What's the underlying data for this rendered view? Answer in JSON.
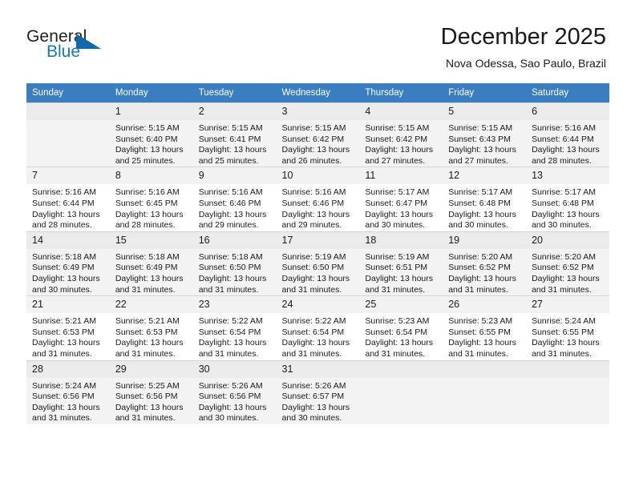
{
  "brand": {
    "name_top": "General",
    "name_bottom": "Blue",
    "color_primary": "#1268ad",
    "color_text": "#231f20"
  },
  "header": {
    "month_title": "December 2025",
    "location": "Nova Odessa, Sao Paulo, Brazil"
  },
  "calendar": {
    "header_bg": "#3a7dc0",
    "header_text_color": "#ffffff",
    "weekday_headers": [
      "Sunday",
      "Monday",
      "Tuesday",
      "Wednesday",
      "Thursday",
      "Friday",
      "Saturday"
    ],
    "weeks": [
      [
        {
          "day": "",
          "sunrise": "",
          "sunset": "",
          "daylight_line1": "",
          "daylight_line2": ""
        },
        {
          "day": "1",
          "sunrise": "Sunrise: 5:15 AM",
          "sunset": "Sunset: 6:40 PM",
          "daylight_line1": "Daylight: 13 hours",
          "daylight_line2": "and 25 minutes."
        },
        {
          "day": "2",
          "sunrise": "Sunrise: 5:15 AM",
          "sunset": "Sunset: 6:41 PM",
          "daylight_line1": "Daylight: 13 hours",
          "daylight_line2": "and 25 minutes."
        },
        {
          "day": "3",
          "sunrise": "Sunrise: 5:15 AM",
          "sunset": "Sunset: 6:42 PM",
          "daylight_line1": "Daylight: 13 hours",
          "daylight_line2": "and 26 minutes."
        },
        {
          "day": "4",
          "sunrise": "Sunrise: 5:15 AM",
          "sunset": "Sunset: 6:42 PM",
          "daylight_line1": "Daylight: 13 hours",
          "daylight_line2": "and 27 minutes."
        },
        {
          "day": "5",
          "sunrise": "Sunrise: 5:15 AM",
          "sunset": "Sunset: 6:43 PM",
          "daylight_line1": "Daylight: 13 hours",
          "daylight_line2": "and 27 minutes."
        },
        {
          "day": "6",
          "sunrise": "Sunrise: 5:16 AM",
          "sunset": "Sunset: 6:44 PM",
          "daylight_line1": "Daylight: 13 hours",
          "daylight_line2": "and 28 minutes."
        }
      ],
      [
        {
          "day": "7",
          "sunrise": "Sunrise: 5:16 AM",
          "sunset": "Sunset: 6:44 PM",
          "daylight_line1": "Daylight: 13 hours",
          "daylight_line2": "and 28 minutes."
        },
        {
          "day": "8",
          "sunrise": "Sunrise: 5:16 AM",
          "sunset": "Sunset: 6:45 PM",
          "daylight_line1": "Daylight: 13 hours",
          "daylight_line2": "and 28 minutes."
        },
        {
          "day": "9",
          "sunrise": "Sunrise: 5:16 AM",
          "sunset": "Sunset: 6:46 PM",
          "daylight_line1": "Daylight: 13 hours",
          "daylight_line2": "and 29 minutes."
        },
        {
          "day": "10",
          "sunrise": "Sunrise: 5:16 AM",
          "sunset": "Sunset: 6:46 PM",
          "daylight_line1": "Daylight: 13 hours",
          "daylight_line2": "and 29 minutes."
        },
        {
          "day": "11",
          "sunrise": "Sunrise: 5:17 AM",
          "sunset": "Sunset: 6:47 PM",
          "daylight_line1": "Daylight: 13 hours",
          "daylight_line2": "and 30 minutes."
        },
        {
          "day": "12",
          "sunrise": "Sunrise: 5:17 AM",
          "sunset": "Sunset: 6:48 PM",
          "daylight_line1": "Daylight: 13 hours",
          "daylight_line2": "and 30 minutes."
        },
        {
          "day": "13",
          "sunrise": "Sunrise: 5:17 AM",
          "sunset": "Sunset: 6:48 PM",
          "daylight_line1": "Daylight: 13 hours",
          "daylight_line2": "and 30 minutes."
        }
      ],
      [
        {
          "day": "14",
          "sunrise": "Sunrise: 5:18 AM",
          "sunset": "Sunset: 6:49 PM",
          "daylight_line1": "Daylight: 13 hours",
          "daylight_line2": "and 30 minutes."
        },
        {
          "day": "15",
          "sunrise": "Sunrise: 5:18 AM",
          "sunset": "Sunset: 6:49 PM",
          "daylight_line1": "Daylight: 13 hours",
          "daylight_line2": "and 31 minutes."
        },
        {
          "day": "16",
          "sunrise": "Sunrise: 5:18 AM",
          "sunset": "Sunset: 6:50 PM",
          "daylight_line1": "Daylight: 13 hours",
          "daylight_line2": "and 31 minutes."
        },
        {
          "day": "17",
          "sunrise": "Sunrise: 5:19 AM",
          "sunset": "Sunset: 6:50 PM",
          "daylight_line1": "Daylight: 13 hours",
          "daylight_line2": "and 31 minutes."
        },
        {
          "day": "18",
          "sunrise": "Sunrise: 5:19 AM",
          "sunset": "Sunset: 6:51 PM",
          "daylight_line1": "Daylight: 13 hours",
          "daylight_line2": "and 31 minutes."
        },
        {
          "day": "19",
          "sunrise": "Sunrise: 5:20 AM",
          "sunset": "Sunset: 6:52 PM",
          "daylight_line1": "Daylight: 13 hours",
          "daylight_line2": "and 31 minutes."
        },
        {
          "day": "20",
          "sunrise": "Sunrise: 5:20 AM",
          "sunset": "Sunset: 6:52 PM",
          "daylight_line1": "Daylight: 13 hours",
          "daylight_line2": "and 31 minutes."
        }
      ],
      [
        {
          "day": "21",
          "sunrise": "Sunrise: 5:21 AM",
          "sunset": "Sunset: 6:53 PM",
          "daylight_line1": "Daylight: 13 hours",
          "daylight_line2": "and 31 minutes."
        },
        {
          "day": "22",
          "sunrise": "Sunrise: 5:21 AM",
          "sunset": "Sunset: 6:53 PM",
          "daylight_line1": "Daylight: 13 hours",
          "daylight_line2": "and 31 minutes."
        },
        {
          "day": "23",
          "sunrise": "Sunrise: 5:22 AM",
          "sunset": "Sunset: 6:54 PM",
          "daylight_line1": "Daylight: 13 hours",
          "daylight_line2": "and 31 minutes."
        },
        {
          "day": "24",
          "sunrise": "Sunrise: 5:22 AM",
          "sunset": "Sunset: 6:54 PM",
          "daylight_line1": "Daylight: 13 hours",
          "daylight_line2": "and 31 minutes."
        },
        {
          "day": "25",
          "sunrise": "Sunrise: 5:23 AM",
          "sunset": "Sunset: 6:54 PM",
          "daylight_line1": "Daylight: 13 hours",
          "daylight_line2": "and 31 minutes."
        },
        {
          "day": "26",
          "sunrise": "Sunrise: 5:23 AM",
          "sunset": "Sunset: 6:55 PM",
          "daylight_line1": "Daylight: 13 hours",
          "daylight_line2": "and 31 minutes."
        },
        {
          "day": "27",
          "sunrise": "Sunrise: 5:24 AM",
          "sunset": "Sunset: 6:55 PM",
          "daylight_line1": "Daylight: 13 hours",
          "daylight_line2": "and 31 minutes."
        }
      ],
      [
        {
          "day": "28",
          "sunrise": "Sunrise: 5:24 AM",
          "sunset": "Sunset: 6:56 PM",
          "daylight_line1": "Daylight: 13 hours",
          "daylight_line2": "and 31 minutes."
        },
        {
          "day": "29",
          "sunrise": "Sunrise: 5:25 AM",
          "sunset": "Sunset: 6:56 PM",
          "daylight_line1": "Daylight: 13 hours",
          "daylight_line2": "and 31 minutes."
        },
        {
          "day": "30",
          "sunrise": "Sunrise: 5:26 AM",
          "sunset": "Sunset: 6:56 PM",
          "daylight_line1": "Daylight: 13 hours",
          "daylight_line2": "and 30 minutes."
        },
        {
          "day": "31",
          "sunrise": "Sunrise: 5:26 AM",
          "sunset": "Sunset: 6:57 PM",
          "daylight_line1": "Daylight: 13 hours",
          "daylight_line2": "and 30 minutes."
        },
        {
          "day": "",
          "sunrise": "",
          "sunset": "",
          "daylight_line1": "",
          "daylight_line2": ""
        },
        {
          "day": "",
          "sunrise": "",
          "sunset": "",
          "daylight_line1": "",
          "daylight_line2": ""
        },
        {
          "day": "",
          "sunrise": "",
          "sunset": "",
          "daylight_line1": "",
          "daylight_line2": ""
        }
      ]
    ]
  }
}
